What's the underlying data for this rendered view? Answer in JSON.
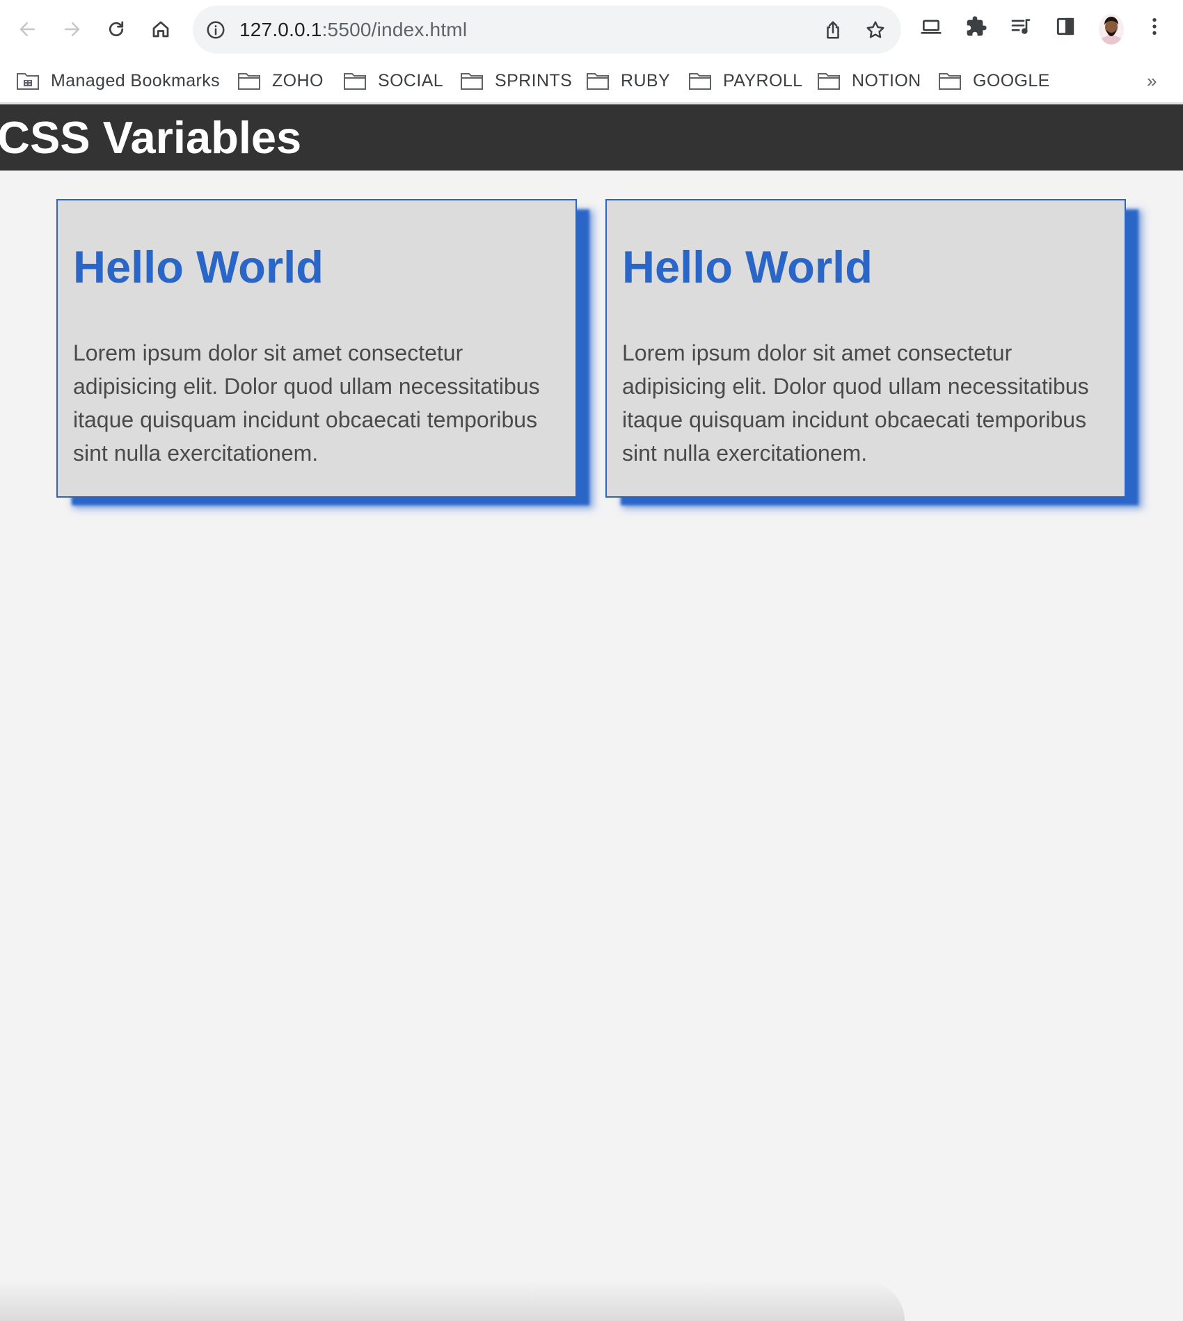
{
  "browser": {
    "url_host": "127.0.0.1",
    "url_rest": ":5500/index.html"
  },
  "bookmarks": [
    {
      "label": "Managed Bookmarks"
    },
    {
      "label": "ZOHO"
    },
    {
      "label": "SOCIAL"
    },
    {
      "label": "SPRINTS"
    },
    {
      "label": "RUBY"
    },
    {
      "label": "PAYROLL"
    },
    {
      "label": "NOTION"
    },
    {
      "label": "GOOGLE"
    }
  ],
  "bookmarks_overflow": "»",
  "page": {
    "header_title": "CSS Variables",
    "cards": [
      {
        "title": "Hello World",
        "body": "Lorem ipsum dolor sit amet consectetur adipisicing elit. Dolor quod ullam necessitatibus itaque quisquam incidunt obcaecati temporibus sint nulla exercitationem."
      },
      {
        "title": "Hello World",
        "body": "Lorem ipsum dolor sit amet consectetur adipisicing elit. Dolor quod ullam necessitatibus itaque quisquam incidunt obcaecati temporibus sint nulla exercitationem."
      }
    ]
  },
  "colors": {
    "header_bg": "#333333",
    "accent": "#2a65c8",
    "card_bg": "#dcdcdd",
    "page_bg": "#f3f3f4"
  },
  "icons": {
    "back": "arrow-left-icon",
    "forward": "arrow-right-icon",
    "reload": "reload-icon",
    "home": "home-icon",
    "site_info": "info-icon",
    "share": "share-icon",
    "bookmark_star": "star-icon",
    "cast": "laptop-icon",
    "extensions": "puzzle-icon",
    "media": "media-queue-icon",
    "side_panel": "side-panel-icon",
    "menu": "kebab-menu-icon"
  }
}
